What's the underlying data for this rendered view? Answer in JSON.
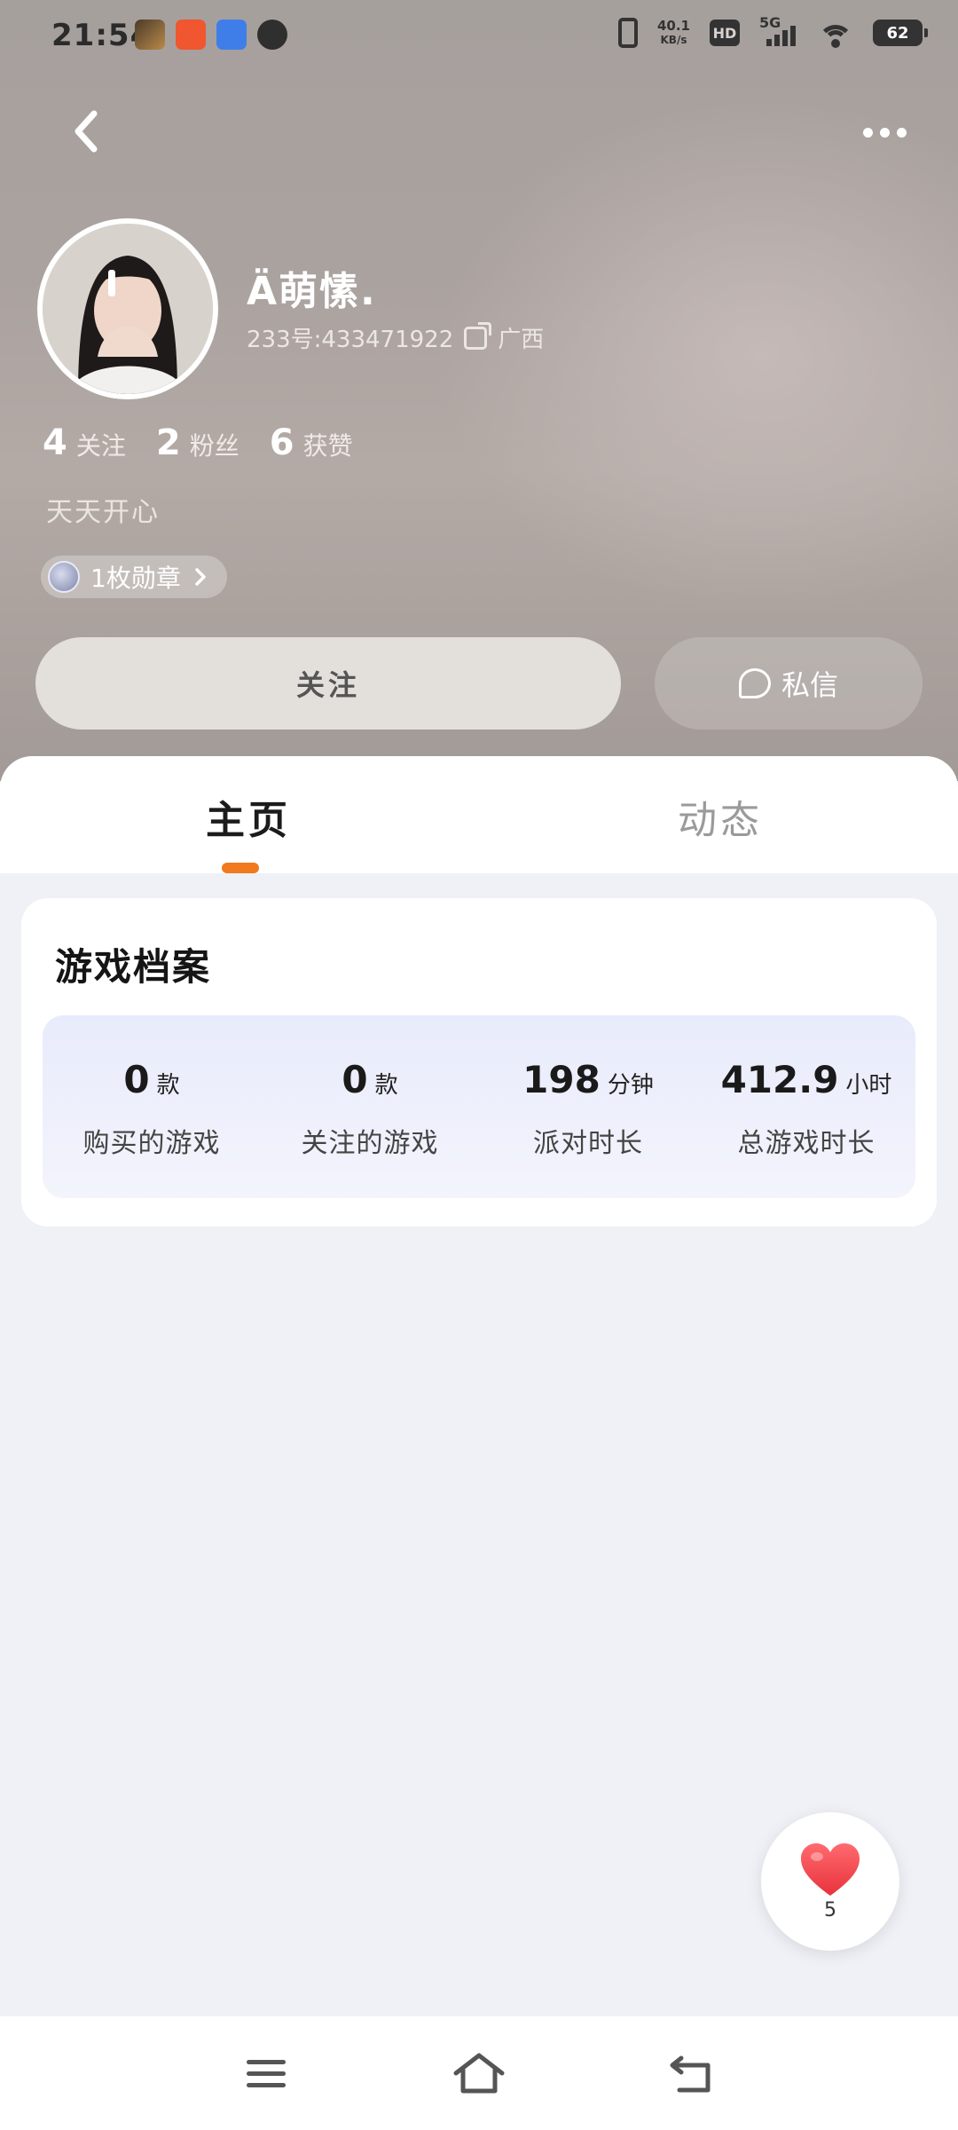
{
  "status_bar": {
    "time": "21:54",
    "net_speed_value": "40.1",
    "net_speed_unit": "KB/s",
    "hd_label": "HD",
    "network": "5G",
    "battery": "62",
    "icons": [
      "app-notification-icon",
      "video-app-icon",
      "baidu-app-icon",
      "message-bubble-icon",
      "vibrate-icon",
      "signal-icon",
      "wifi-icon",
      "battery-icon"
    ]
  },
  "header": {
    "back_icon": "chevron-left-icon",
    "more_icon": "more-dots-icon"
  },
  "profile": {
    "username": "Ä萌愫.",
    "account_id": "233号:433471922",
    "location": "广西",
    "bio": "天天开心",
    "stats": [
      {
        "value": "4",
        "label": "关注"
      },
      {
        "value": "2",
        "label": "粉丝"
      },
      {
        "value": "6",
        "label": "获赞"
      }
    ],
    "medal_label": "1枚勋章"
  },
  "actions": {
    "follow_label": "关注",
    "message_label": "私信"
  },
  "tabs": [
    {
      "label": "主页",
      "active": true
    },
    {
      "label": "动态",
      "active": false
    }
  ],
  "game_profile": {
    "title": "游戏档案",
    "stats": [
      {
        "value": "0",
        "unit": "款",
        "label": "购买的游戏"
      },
      {
        "value": "0",
        "unit": "款",
        "label": "关注的游戏"
      },
      {
        "value": "198",
        "unit": "分钟",
        "label": "派对时长"
      },
      {
        "value": "412.9",
        "unit": "小时",
        "label": "总游戏时长"
      }
    ]
  },
  "like_fab": {
    "count": "5",
    "icon": "heart-icon"
  },
  "nav_bar": {
    "icons": [
      "menu-icon",
      "home-icon",
      "back-icon"
    ]
  },
  "colors": {
    "accent_orange": "#f07a1d",
    "heart_red": "#f2434b",
    "page_bg": "#eff1f6"
  }
}
